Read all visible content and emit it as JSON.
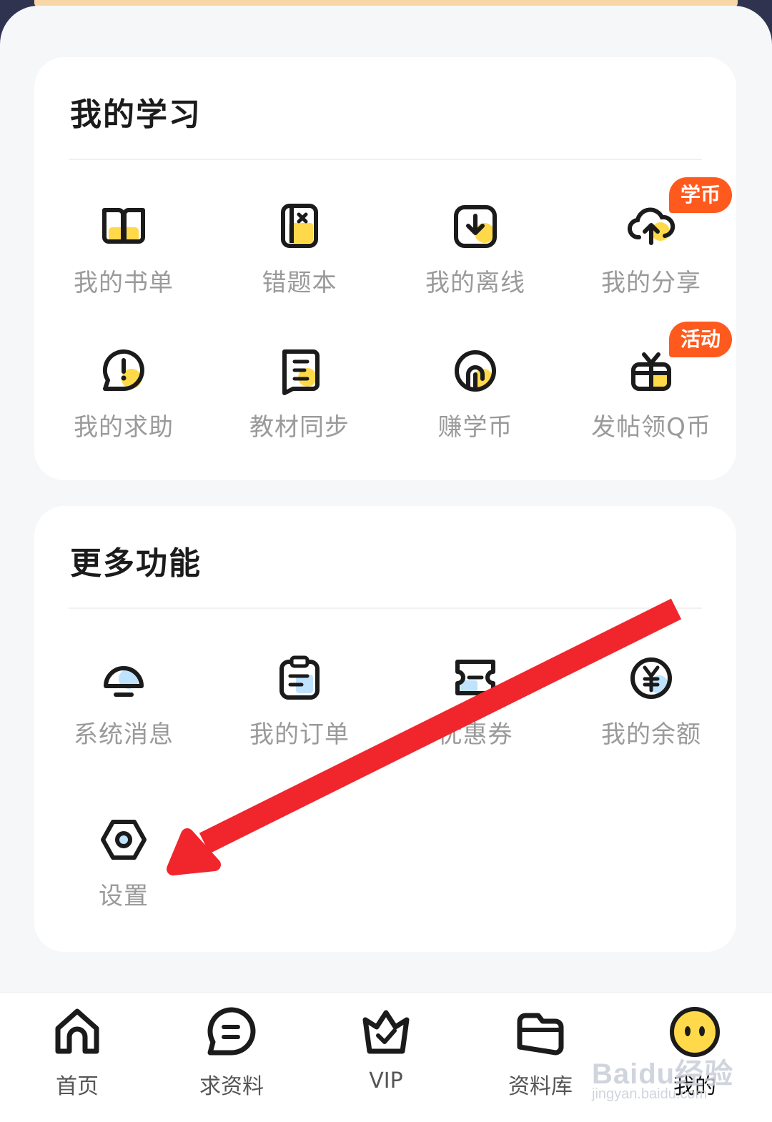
{
  "study_section": {
    "title": "我的学习",
    "items": [
      {
        "label": "我的书单",
        "icon": "book-open-icon"
      },
      {
        "label": "错题本",
        "icon": "error-notebook-icon"
      },
      {
        "label": "我的离线",
        "icon": "offline-download-icon"
      },
      {
        "label": "我的分享",
        "icon": "cloud-upload-icon",
        "badge": "学币"
      },
      {
        "label": "我的求助",
        "icon": "help-bubble-icon"
      },
      {
        "label": "教材同步",
        "icon": "textbook-sync-icon"
      },
      {
        "label": "赚学币",
        "icon": "earn-coin-icon"
      },
      {
        "label": "发帖领Q币",
        "icon": "gift-icon",
        "badge": "活动"
      }
    ]
  },
  "more_section": {
    "title": "更多功能",
    "items": [
      {
        "label": "系统消息",
        "icon": "bell-icon"
      },
      {
        "label": "我的订单",
        "icon": "clipboard-order-icon"
      },
      {
        "label": "优惠券",
        "icon": "coupon-icon"
      },
      {
        "label": "我的余额",
        "icon": "yen-balance-icon"
      },
      {
        "label": "设置",
        "icon": "settings-gear-icon"
      }
    ]
  },
  "nav": {
    "items": [
      {
        "label": "首页",
        "icon": "home-icon"
      },
      {
        "label": "求资料",
        "icon": "chat-request-icon"
      },
      {
        "label": "VIP",
        "icon": "vip-crown-icon"
      },
      {
        "label": "资料库",
        "icon": "folder-library-icon"
      },
      {
        "label": "我的",
        "icon": "profile-face-icon",
        "active": true
      }
    ]
  },
  "watermark": {
    "line1": "Baidu经验",
    "line2": "jingyan.baidu.com"
  },
  "colors": {
    "accent": "#ffd94a",
    "badge": "#ff5a1e",
    "icon_stroke": "#1b1b1b",
    "light_blue": "#bfe3ff",
    "annotation_arrow": "#f0262c"
  }
}
